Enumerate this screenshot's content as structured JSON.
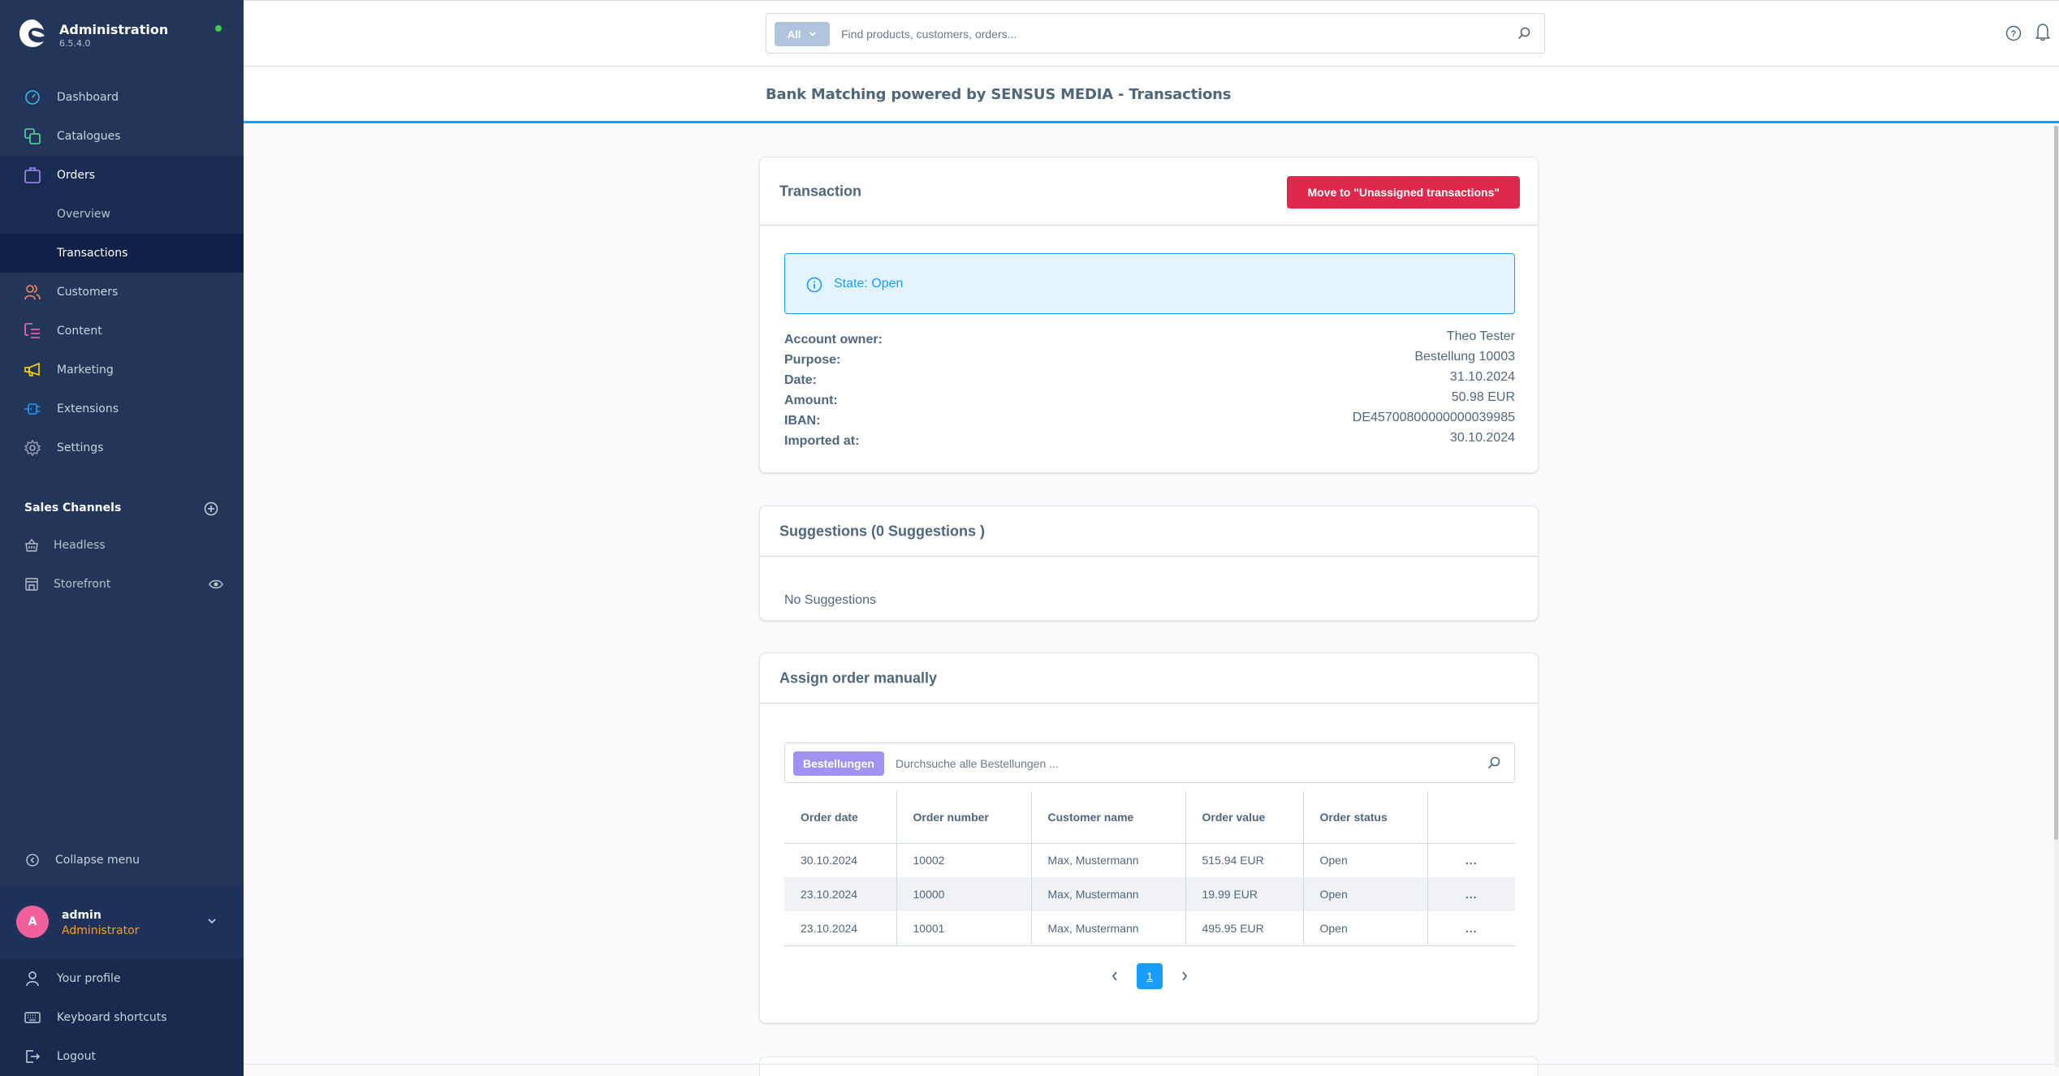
{
  "app": {
    "title": "Administration",
    "version": "6.5.4.0",
    "status_color": "#37d046"
  },
  "sidebar": {
    "nav": [
      {
        "label": "Dashboard",
        "icon": "dashboard-icon",
        "color": "#3cb4e6"
      },
      {
        "label": "Catalogues",
        "icon": "catalogues-icon",
        "color": "#57d9a3"
      },
      {
        "label": "Orders",
        "icon": "orders-icon",
        "color": "#9e8ffa"
      },
      {
        "label": "Customers",
        "icon": "customers-icon",
        "color": "#f88962"
      },
      {
        "label": "Content",
        "icon": "content-icon",
        "color": "#ff68b4"
      },
      {
        "label": "Marketing",
        "icon": "marketing-icon",
        "color": "#ffd700"
      },
      {
        "label": "Extensions",
        "icon": "extensions-icon",
        "color": "#189eff"
      },
      {
        "label": "Settings",
        "icon": "settings-icon",
        "color": "#9aa8b5"
      }
    ],
    "orders_sub": [
      {
        "label": "Overview"
      },
      {
        "label": "Transactions",
        "active": true
      }
    ],
    "sales_channels": {
      "title": "Sales Channels",
      "items": [
        {
          "label": "Headless"
        },
        {
          "label": "Storefront"
        }
      ]
    },
    "collapse_label": "Collapse menu",
    "user": {
      "initial": "A",
      "name": "admin",
      "role": "Administrator"
    },
    "user_menu": [
      {
        "label": "Your profile"
      },
      {
        "label": "Keyboard shortcuts"
      },
      {
        "label": "Logout"
      }
    ]
  },
  "topbar": {
    "search_type": "All",
    "search_placeholder": "Find products, customers, orders..."
  },
  "page": {
    "title": "Bank Matching powered by SENSUS MEDIA - Transactions"
  },
  "transaction": {
    "title": "Transaction",
    "move_button": "Move to \"Unassigned transactions\"",
    "state_text": "State: Open",
    "details": [
      {
        "label": "Account owner:",
        "value": "Theo Tester"
      },
      {
        "label": "Purpose:",
        "value": "Bestellung 10003"
      },
      {
        "label": "Date:",
        "value": "31.10.2024"
      },
      {
        "label": "Amount:",
        "value": "50.98 EUR"
      },
      {
        "label": "IBAN:",
        "value": "DE45700800000000039985"
      },
      {
        "label": "Imported at:",
        "value": "30.10.2024"
      }
    ]
  },
  "suggestions": {
    "title": "Suggestions (0 Suggestions )",
    "empty": "No Suggestions"
  },
  "assign": {
    "title": "Assign order manually",
    "search_badge": "Bestellungen",
    "search_placeholder": "Durchsuche alle Bestellungen ...",
    "columns": [
      "Order date",
      "Order number",
      "Customer name",
      "Order value",
      "Order status"
    ],
    "rows": [
      {
        "date": "30.10.2024",
        "number": "10002",
        "customer": "Max, Mustermann",
        "value": "515.94 EUR",
        "status": "Open",
        "actions": "..."
      },
      {
        "date": "23.10.2024",
        "number": "10000",
        "customer": "Max, Mustermann",
        "value": "19.99 EUR",
        "status": "Open",
        "actions": "..."
      },
      {
        "date": "23.10.2024",
        "number": "10001",
        "customer": "Max, Mustermann",
        "value": "495.95 EUR",
        "status": "Open",
        "actions": "..."
      }
    ],
    "current_page": "1"
  }
}
